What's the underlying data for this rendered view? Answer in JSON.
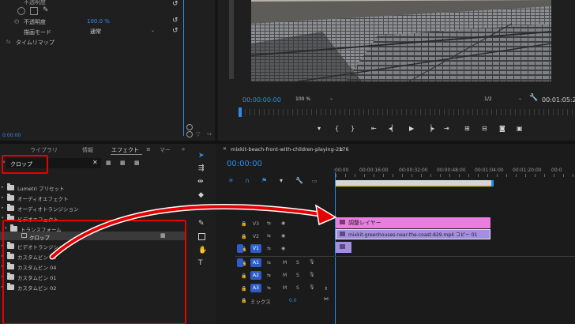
{
  "effect_controls": {
    "opacity_label": "不透明度",
    "opacity_value": "100.0 %",
    "blend_label": "描画モード",
    "blend_value": "通常",
    "time_remap": "タイムリマップ",
    "timecode": "0:00:00"
  },
  "program_monitor": {
    "timecode": "00:00:00:00",
    "zoom": "100 %",
    "quality": "1/2",
    "duration": "00:01:05:2"
  },
  "effects_panel": {
    "tabs": [
      "ライブラリ",
      "情報",
      "エフェクト",
      "マー"
    ],
    "search_value": "クロップ",
    "tree": [
      {
        "label": "Lumetri プリセット"
      },
      {
        "label": "オーディオエフェクト"
      },
      {
        "label": "オーディオトランジション"
      },
      {
        "label": "ビデオエフェクト"
      },
      {
        "label": "トランスフォーム"
      },
      {
        "label": "クロップ"
      },
      {
        "label": "ビデオトランジション"
      },
      {
        "label": "カスタムビン 03"
      },
      {
        "label": "カスタムビン 04"
      },
      {
        "label": "カスタムビン 01"
      },
      {
        "label": "カスタムビン 02"
      }
    ]
  },
  "timeline": {
    "sequence_name": "mixkit-beach-front-with-children-playing-2176",
    "timecode": "00:00:00",
    "ruler": [
      ":00:00",
      "00:00:16:00",
      "00:00:32:00",
      "00:00:48:00",
      "00:01:04:00",
      "00:01:20:00",
      "00:0"
    ],
    "tracks_video": [
      "V3",
      "V2",
      "V1"
    ],
    "tracks_audio": [
      "A1",
      "A2",
      "A3"
    ],
    "mix_label": "ミックス",
    "mix_value": "0.0",
    "clip_adjustment": "調整レイヤー",
    "clip_video": "mixkit-greenhouses-near-the-coast-829.mp4 コピー 01",
    "ms": [
      "M",
      "S"
    ]
  },
  "colors": {
    "accent": "#2d8ceb",
    "highlight_box": "#e60000",
    "clip_pink": "#e97ee0",
    "clip_purple": "#a48ee0",
    "track_blue": "#2f5cc6"
  }
}
